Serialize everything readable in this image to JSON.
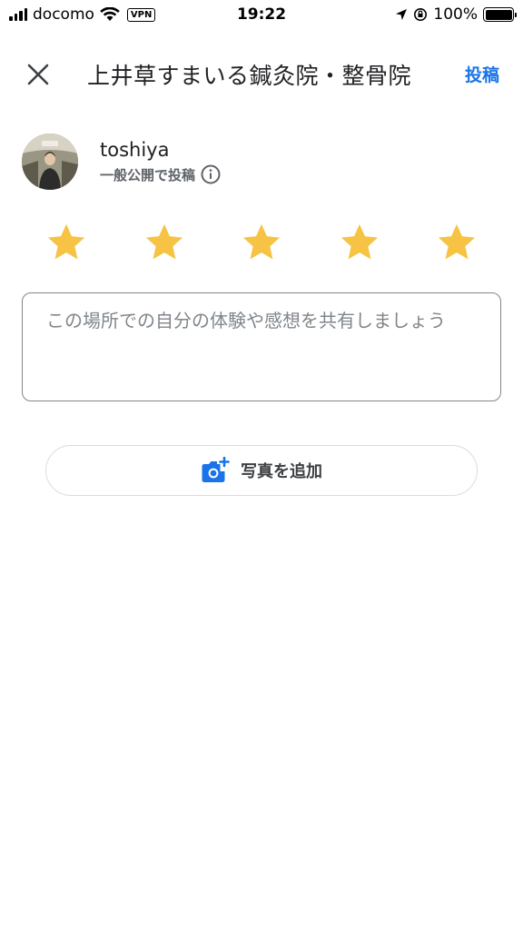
{
  "status_bar": {
    "carrier": "docomo",
    "vpn": "VPN",
    "time": "19:22",
    "battery": "100%"
  },
  "header": {
    "title": "上井草すまいる鍼灸院・整骨院",
    "post_label": "投稿",
    "close_icon": "close-icon"
  },
  "user": {
    "name": "toshiya",
    "visibility": "一般公開で投稿"
  },
  "rating": {
    "value": 5,
    "max": 5,
    "star_color": "#F6C344"
  },
  "review": {
    "placeholder": "この場所での自分の体験や感想を共有しましょう",
    "value": ""
  },
  "add_photo": {
    "label": "写真を追加",
    "icon": "add-photo-icon"
  },
  "colors": {
    "accent": "#1A73E8",
    "text_primary": "#202124",
    "text_secondary": "#5F6368"
  }
}
